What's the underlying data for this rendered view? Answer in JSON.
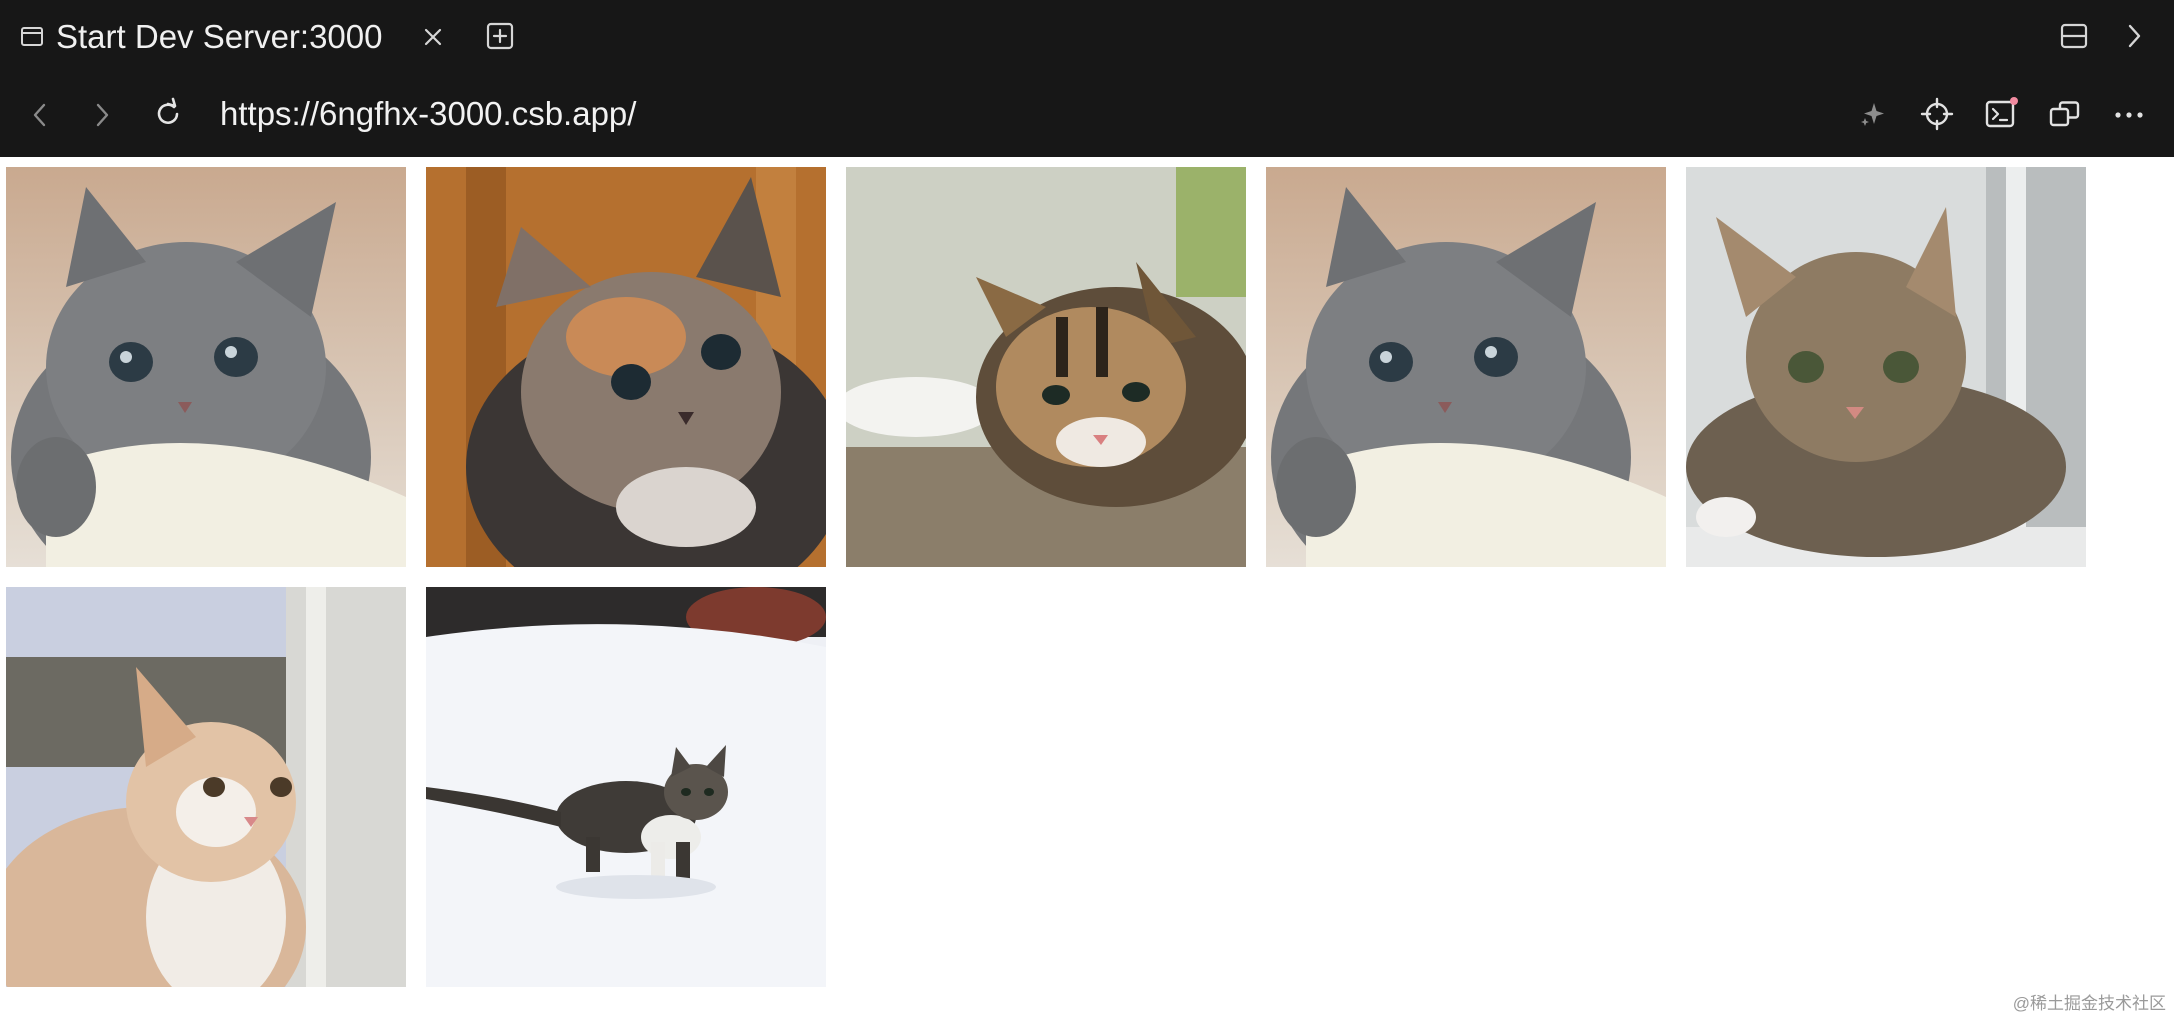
{
  "window": {
    "tab_title": "Start Dev Server:3000",
    "url": "https://6ngfhx-3000.csb.app/"
  },
  "icons": {
    "tab": "browser-tab-icon",
    "close": "close-icon",
    "new_tab": "plus-square-icon",
    "split": "split-panel-icon",
    "chevron_right": "chevron-right-icon",
    "back": "chevron-left-icon",
    "forward": "chevron-right-icon",
    "reload": "reload-icon",
    "ai": "sparkle-icon",
    "inspect": "crosshair-icon",
    "terminal": "terminal-icon",
    "popout": "popout-window-icon",
    "more": "ellipsis-icon"
  },
  "gallery": {
    "images": [
      {
        "subject": "grey fluffy kitten on white knit blanket"
      },
      {
        "subject": "calico kitten against wooden background"
      },
      {
        "subject": "tabby and white kitten peeking over ledge"
      },
      {
        "subject": "grey fluffy kitten on white knit blanket"
      },
      {
        "subject": "tabby kitten lying on windowsill"
      },
      {
        "subject": "orange and white cat beside white post"
      },
      {
        "subject": "tabby and white kitten walking in snow"
      }
    ]
  },
  "watermark": "@稀土掘金技术社区",
  "colors": {
    "chrome_bg": "#171717",
    "icon": "#d6d6d6",
    "terminal_dot": "#f28ba0",
    "page_bg": "#ffffff"
  }
}
